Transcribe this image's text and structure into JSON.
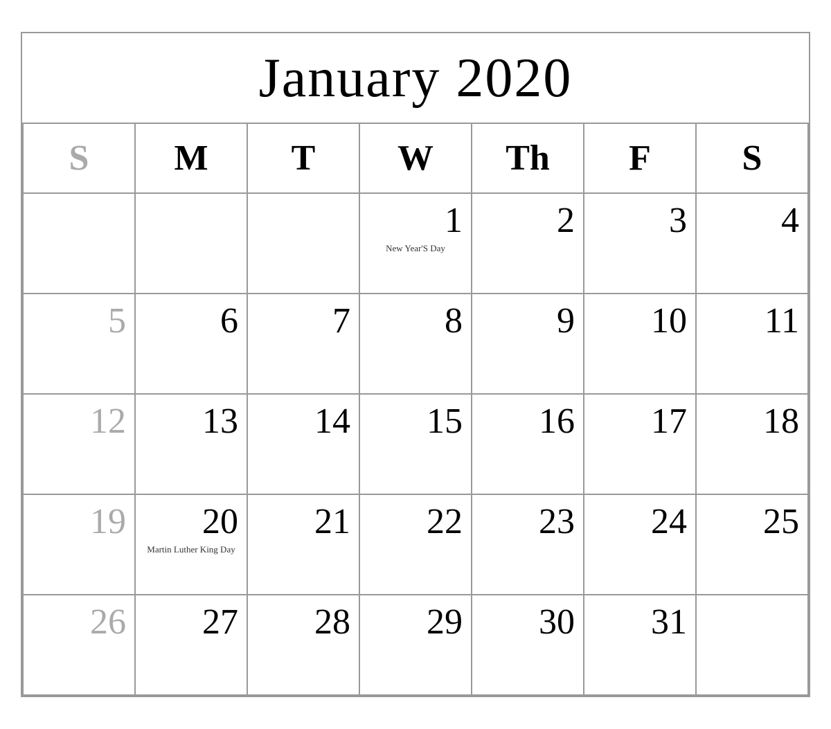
{
  "calendar": {
    "title": "January 2020",
    "headers": [
      {
        "label": "S",
        "is_sunday": true
      },
      {
        "label": "M",
        "is_sunday": false
      },
      {
        "label": "T",
        "is_sunday": false
      },
      {
        "label": "W",
        "is_sunday": false
      },
      {
        "label": "Th",
        "is_sunday": false
      },
      {
        "label": "F",
        "is_sunday": false
      },
      {
        "label": "S",
        "is_sunday": false
      }
    ],
    "weeks": [
      [
        {
          "day": "",
          "empty": true,
          "sunday": true
        },
        {
          "day": "",
          "empty": true,
          "sunday": false
        },
        {
          "day": "",
          "empty": true,
          "sunday": false
        },
        {
          "day": "1",
          "empty": false,
          "sunday": false,
          "holiday": "New Year'S Day"
        },
        {
          "day": "2",
          "empty": false,
          "sunday": false
        },
        {
          "day": "3",
          "empty": false,
          "sunday": false
        },
        {
          "day": "4",
          "empty": false,
          "sunday": false
        }
      ],
      [
        {
          "day": "5",
          "empty": false,
          "sunday": true
        },
        {
          "day": "6",
          "empty": false,
          "sunday": false
        },
        {
          "day": "7",
          "empty": false,
          "sunday": false
        },
        {
          "day": "8",
          "empty": false,
          "sunday": false
        },
        {
          "day": "9",
          "empty": false,
          "sunday": false
        },
        {
          "day": "10",
          "empty": false,
          "sunday": false
        },
        {
          "day": "11",
          "empty": false,
          "sunday": false
        }
      ],
      [
        {
          "day": "12",
          "empty": false,
          "sunday": true
        },
        {
          "day": "13",
          "empty": false,
          "sunday": false
        },
        {
          "day": "14",
          "empty": false,
          "sunday": false
        },
        {
          "day": "15",
          "empty": false,
          "sunday": false
        },
        {
          "day": "16",
          "empty": false,
          "sunday": false
        },
        {
          "day": "17",
          "empty": false,
          "sunday": false
        },
        {
          "day": "18",
          "empty": false,
          "sunday": false
        }
      ],
      [
        {
          "day": "19",
          "empty": false,
          "sunday": true
        },
        {
          "day": "20",
          "empty": false,
          "sunday": false,
          "holiday": "Martin Luther King Day"
        },
        {
          "day": "21",
          "empty": false,
          "sunday": false
        },
        {
          "day": "22",
          "empty": false,
          "sunday": false
        },
        {
          "day": "23",
          "empty": false,
          "sunday": false
        },
        {
          "day": "24",
          "empty": false,
          "sunday": false
        },
        {
          "day": "25",
          "empty": false,
          "sunday": false
        }
      ],
      [
        {
          "day": "26",
          "empty": false,
          "sunday": true
        },
        {
          "day": "27",
          "empty": false,
          "sunday": false
        },
        {
          "day": "28",
          "empty": false,
          "sunday": false
        },
        {
          "day": "29",
          "empty": false,
          "sunday": false
        },
        {
          "day": "30",
          "empty": false,
          "sunday": false
        },
        {
          "day": "31",
          "empty": false,
          "sunday": false
        },
        {
          "day": "",
          "empty": true,
          "sunday": false
        }
      ]
    ]
  }
}
